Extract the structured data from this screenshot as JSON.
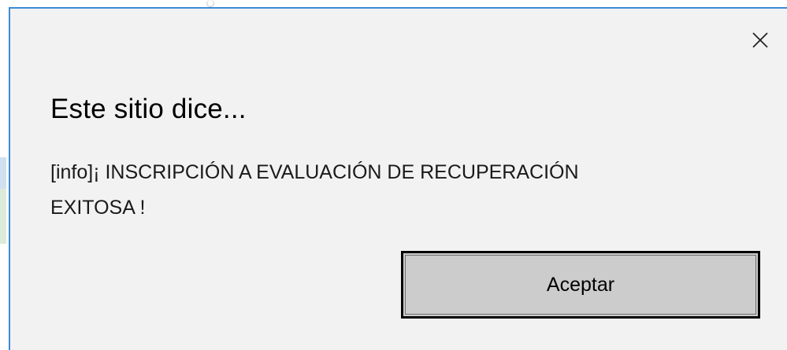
{
  "dialog": {
    "title": "Este sitio dice...",
    "message_line_1": "[info]¡ INSCRIPCIÓN A EVALUACIÓN DE RECUPERACIÓN",
    "message_line_2": "EXITOSA !",
    "accept_label": "Aceptar",
    "close_icon": "close-icon"
  },
  "colors": {
    "dialog_background": "#f2f2f2",
    "dialog_border": "#3b8ad9",
    "button_background": "#cccccc",
    "button_border": "#000000"
  }
}
